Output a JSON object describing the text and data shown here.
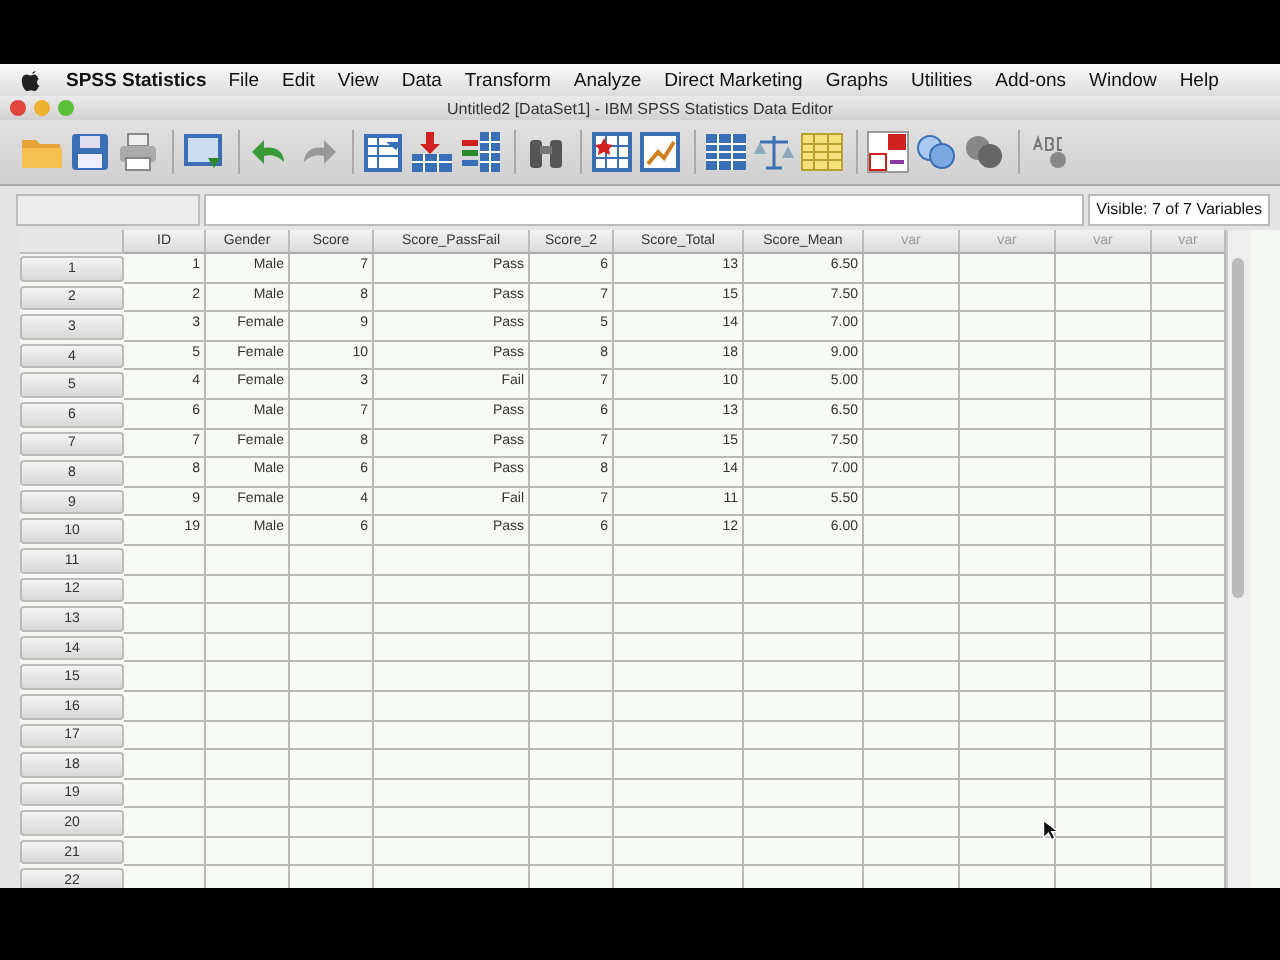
{
  "menu_bar": {
    "app_name": "SPSS Statistics",
    "items": [
      "File",
      "Edit",
      "View",
      "Data",
      "Transform",
      "Analyze",
      "Direct Marketing",
      "Graphs",
      "Utilities",
      "Add-ons",
      "Window",
      "Help"
    ]
  },
  "window": {
    "title": "Untitled2 [DataSet1] - IBM SPSS Statistics Data Editor"
  },
  "info_bar": {
    "visible_variables": "Visible: 7 of 7 Variables"
  },
  "table": {
    "columns": [
      "ID",
      "Gender",
      "Score",
      "Score_PassFail",
      "Score_2",
      "Score_Total",
      "Score_Mean",
      "var",
      "var",
      "var",
      "var"
    ],
    "rows": [
      {
        "number": "1",
        "cells": [
          "1",
          "Male",
          "7",
          "Pass",
          "6",
          "13",
          "6.50"
        ]
      },
      {
        "number": "2",
        "cells": [
          "2",
          "Male",
          "8",
          "Pass",
          "7",
          "15",
          "7.50"
        ]
      },
      {
        "number": "3",
        "cells": [
          "3",
          "Female",
          "9",
          "Pass",
          "5",
          "14",
          "7.00"
        ]
      },
      {
        "number": "4",
        "cells": [
          "5",
          "Female",
          "10",
          "Pass",
          "8",
          "18",
          "9.00"
        ]
      },
      {
        "number": "5",
        "cells": [
          "4",
          "Female",
          "3",
          "Fail",
          "7",
          "10",
          "5.00"
        ]
      },
      {
        "number": "6",
        "cells": [
          "6",
          "Male",
          "7",
          "Pass",
          "6",
          "13",
          "6.50"
        ]
      },
      {
        "number": "7",
        "cells": [
          "7",
          "Female",
          "8",
          "Pass",
          "7",
          "15",
          "7.50"
        ]
      },
      {
        "number": "8",
        "cells": [
          "8",
          "Male",
          "6",
          "Pass",
          "8",
          "14",
          "7.00"
        ]
      },
      {
        "number": "9",
        "cells": [
          "9",
          "Female",
          "4",
          "Fail",
          "7",
          "11",
          "5.50"
        ]
      },
      {
        "number": "10",
        "cells": [
          "19",
          "Male",
          "6",
          "Pass",
          "6",
          "12",
          "6.00"
        ]
      },
      {
        "number": "11",
        "cells": []
      },
      {
        "number": "12",
        "cells": []
      },
      {
        "number": "13",
        "cells": []
      },
      {
        "number": "14",
        "cells": []
      },
      {
        "number": "15",
        "cells": []
      },
      {
        "number": "16",
        "cells": []
      },
      {
        "number": "17",
        "cells": []
      },
      {
        "number": "18",
        "cells": []
      },
      {
        "number": "19",
        "cells": []
      },
      {
        "number": "20",
        "cells": []
      },
      {
        "number": "21",
        "cells": []
      },
      {
        "number": "22",
        "cells": []
      }
    ]
  }
}
